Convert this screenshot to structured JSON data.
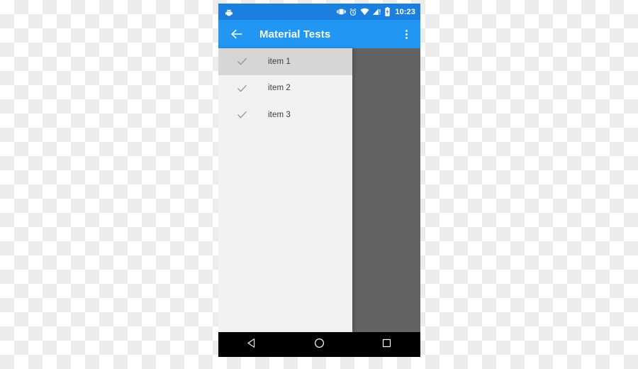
{
  "screen": {
    "platform": "android",
    "accent_color": "#2196f3",
    "status_bar_color": "#1b7fe0",
    "drawer_background": "#f2f2f2",
    "scrim_color": "#636363",
    "selected_item_background": "#d6d6d6"
  },
  "status_bar": {
    "left_icons": [
      {
        "name": "adb-icon",
        "label": "USB debugging connected"
      }
    ],
    "right_icons": [
      {
        "name": "vibrate-icon",
        "label": "Ringer vibrate"
      },
      {
        "name": "alarm-icon",
        "label": "Alarm set"
      },
      {
        "name": "wifi-icon",
        "label": "Wi-Fi connected"
      },
      {
        "name": "cellular-signal-icon",
        "label": "Mobile signal, no service"
      },
      {
        "name": "battery-icon",
        "label": "Battery charging"
      }
    ],
    "clock": "10:23"
  },
  "toolbar": {
    "up_icon": "arrow-back-icon",
    "title": "Material Tests",
    "overflow_icon": "more-vert-icon",
    "overflow_label": "More options"
  },
  "drawer": {
    "items": [
      {
        "label": "item 1",
        "icon": "check-icon",
        "selected": true
      },
      {
        "label": "item 2",
        "icon": "check-icon",
        "selected": false
      },
      {
        "label": "item 3",
        "icon": "check-icon",
        "selected": false
      }
    ]
  },
  "navigation_bar": {
    "buttons": [
      {
        "name": "back-button",
        "icon": "triangle-back-icon",
        "label": "Back"
      },
      {
        "name": "home-button",
        "icon": "circle-home-icon",
        "label": "Home"
      },
      {
        "name": "recents-button",
        "icon": "square-recents-icon",
        "label": "Recents"
      }
    ]
  }
}
